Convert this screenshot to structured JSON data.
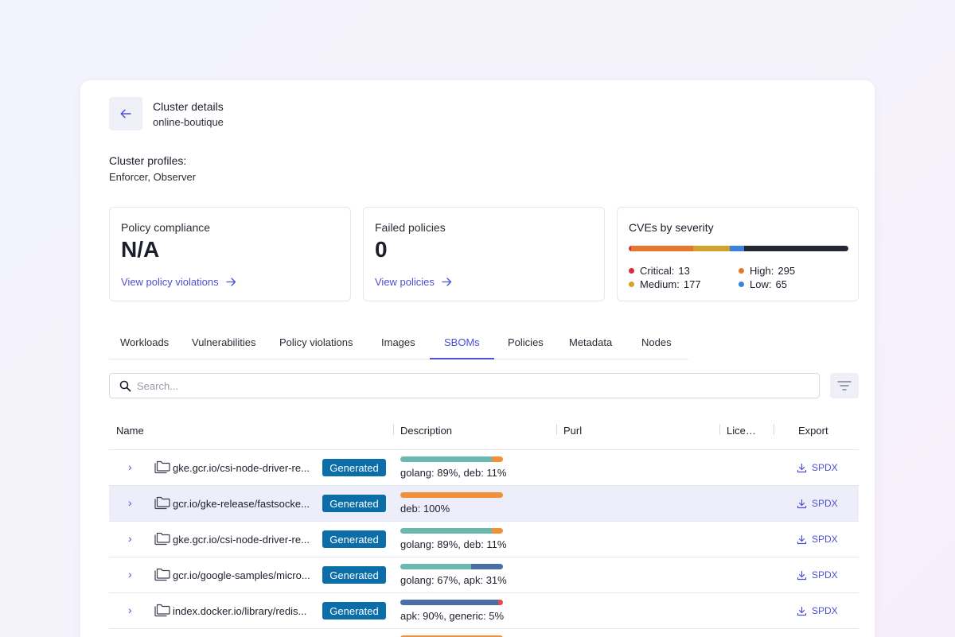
{
  "header": {
    "title": "Cluster details",
    "subtitle": "online-boutique",
    "back_icon": "arrow-left-icon"
  },
  "profiles": {
    "label": "Cluster profiles:",
    "value": "Enforcer, Observer"
  },
  "stats": {
    "compliance": {
      "label": "Policy compliance",
      "value": "N/A",
      "link": "View policy violations"
    },
    "failed": {
      "label": "Failed policies",
      "value": "0",
      "link": "View policies"
    }
  },
  "cves": {
    "title": "CVEs by severity",
    "items": [
      {
        "name": "Critical:",
        "count": "13",
        "color": "#d92d3a"
      },
      {
        "name": "High:",
        "count": "295",
        "color": "#e8772e"
      },
      {
        "name": "Medium:",
        "count": "177",
        "color": "#d4a12a"
      },
      {
        "name": "Low:",
        "count": "65",
        "color": "#3b82e0"
      }
    ],
    "bar": [
      {
        "value": 13,
        "color": "#d92d3a"
      },
      {
        "value": 295,
        "color": "#e8772e"
      },
      {
        "value": 177,
        "color": "#d4a12a"
      },
      {
        "value": 65,
        "color": "#3b82e0"
      },
      {
        "value": 500,
        "color": "#252833"
      }
    ]
  },
  "tabs": [
    "Workloads",
    "Vulnerabilities",
    "Policy violations",
    "Images",
    "SBOMs",
    "Policies",
    "Metadata",
    "Nodes"
  ],
  "active_tab": "SBOMs",
  "search": {
    "placeholder": "Search..."
  },
  "table": {
    "headers": {
      "name": "Name",
      "description": "Description",
      "purl": "Purl",
      "license": "Lice…",
      "export": "Export"
    },
    "rows": [
      {
        "name": "gke.gcr.io/csi-node-driver-re...",
        "badge": "Generated",
        "desc": "golang: 89%, deb: 11%",
        "segments": [
          {
            "pct": 89,
            "color": "#6bb8b0"
          },
          {
            "pct": 11,
            "color": "#f0913a"
          }
        ],
        "export": "SPDX",
        "highlight": false
      },
      {
        "name": "gcr.io/gke-release/fastsocke...",
        "badge": "Generated",
        "desc": "deb: 100%",
        "segments": [
          {
            "pct": 100,
            "color": "#f0913a"
          }
        ],
        "export": "SPDX",
        "highlight": true
      },
      {
        "name": "gke.gcr.io/csi-node-driver-re...",
        "badge": "Generated",
        "desc": "golang: 89%, deb: 11%",
        "segments": [
          {
            "pct": 89,
            "color": "#6bb8b0"
          },
          {
            "pct": 11,
            "color": "#f0913a"
          }
        ],
        "export": "SPDX",
        "highlight": false
      },
      {
        "name": "gcr.io/google-samples/micro...",
        "badge": "Generated",
        "desc": "golang: 67%, apk: 31%",
        "segments": [
          {
            "pct": 69,
            "color": "#6bb8b0"
          },
          {
            "pct": 31,
            "color": "#4a6fa5"
          }
        ],
        "export": "SPDX",
        "highlight": false
      },
      {
        "name": "index.docker.io/library/redis...",
        "badge": "Generated",
        "desc": "apk: 90%, generic: 5%",
        "segments": [
          {
            "pct": 95,
            "color": "#4a6fa5"
          },
          {
            "pct": 5,
            "color": "#e84a4a"
          }
        ],
        "export": "SPDX",
        "highlight": false
      },
      {
        "name": "",
        "badge": "",
        "desc": "",
        "segments": [
          {
            "pct": 100,
            "color": "#f0913a"
          }
        ],
        "export": "",
        "highlight": false
      }
    ]
  }
}
